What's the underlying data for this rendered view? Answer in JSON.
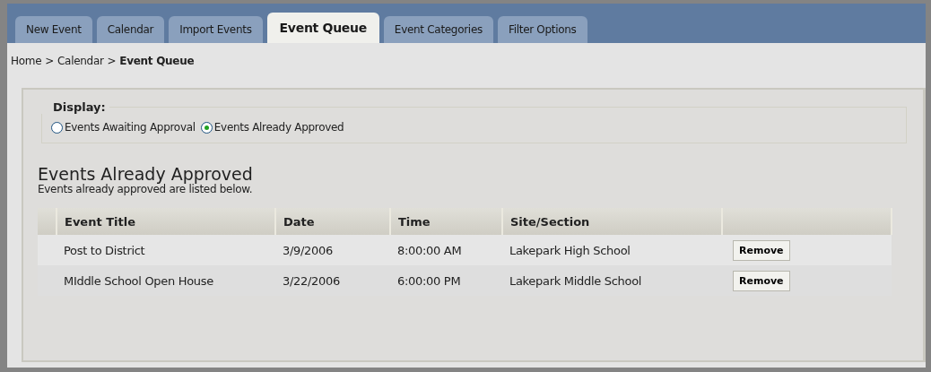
{
  "tabs": [
    {
      "label": "New Event",
      "selected": false
    },
    {
      "label": "Calendar",
      "selected": false
    },
    {
      "label": "Import Events",
      "selected": false
    },
    {
      "label": "Event Queue",
      "selected": true
    },
    {
      "label": "Event Categories",
      "selected": false
    },
    {
      "label": "Filter Options",
      "selected": false
    }
  ],
  "breadcrumb": {
    "links": [
      "Home",
      "Calendar"
    ],
    "separator": ">",
    "current": "Event Queue"
  },
  "display": {
    "legend": "Display:",
    "options": [
      {
        "label": "Events Awaiting Approval",
        "selected": false
      },
      {
        "label": "Events Already Approved",
        "selected": true
      }
    ]
  },
  "section": {
    "title": "Events Already Approved",
    "description": "Events already approved are listed below."
  },
  "table": {
    "columns": [
      "Event Title",
      "Date",
      "Time",
      "Site/Section"
    ],
    "rows": [
      {
        "cells": [
          "Post to District",
          "3/9/2006",
          "8:00:00 AM",
          "Lakepark High School"
        ],
        "action": "Remove"
      },
      {
        "cells": [
          "MIddle School Open House",
          "3/22/2006",
          "6:00:00 PM",
          "Lakepark Middle School"
        ],
        "action": "Remove"
      }
    ]
  }
}
